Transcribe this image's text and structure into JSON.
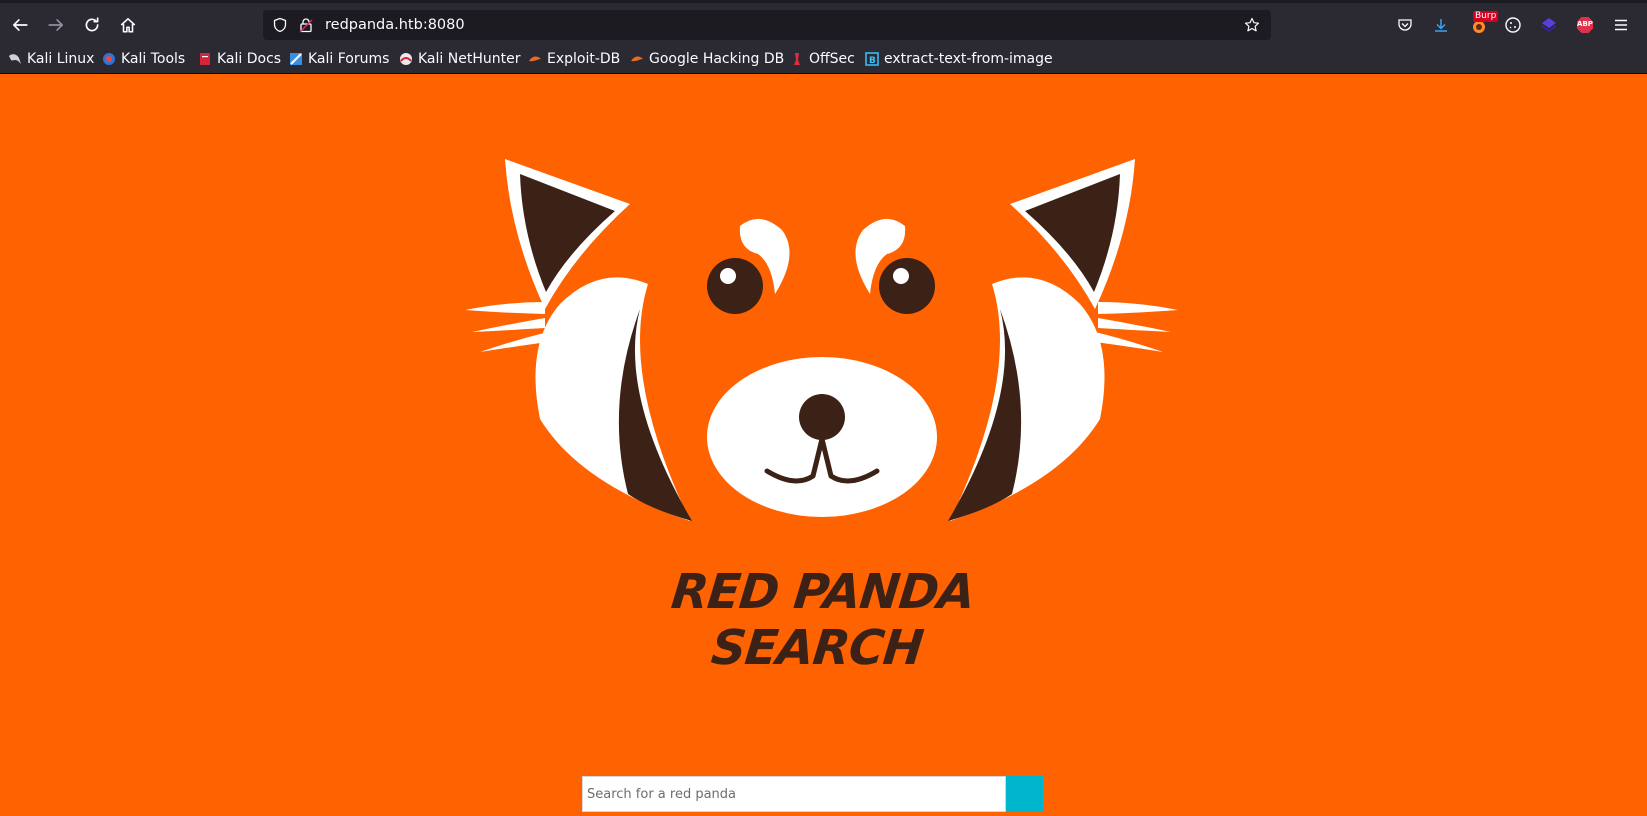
{
  "browser": {
    "url": "redpanda.htb:8080",
    "bookmarks": [
      {
        "label": "Kali Linux",
        "icon": "kali-dragon-icon"
      },
      {
        "label": "Kali Tools",
        "icon": "kali-tools-icon"
      },
      {
        "label": "Kali Docs",
        "icon": "kali-docs-icon"
      },
      {
        "label": "Kali Forums",
        "icon": "kali-forums-icon"
      },
      {
        "label": "Kali NetHunter",
        "icon": "nethunter-icon"
      },
      {
        "label": "Exploit-DB",
        "icon": "exploit-db-icon"
      },
      {
        "label": "Google Hacking DB",
        "icon": "ghdb-icon"
      },
      {
        "label": "OffSec",
        "icon": "offsec-icon"
      },
      {
        "label": "extract-text-from-image",
        "icon": "bookmark-b-icon"
      }
    ],
    "extensions": {
      "burp_badge": "Burp",
      "abp_label": "ABP"
    }
  },
  "page": {
    "brand_title": "RED PANDA SEARCH",
    "search": {
      "placeholder": "Search for a red panda",
      "value": ""
    }
  },
  "colors": {
    "background": "#ff6200",
    "panda_dark": "#3b2116",
    "panda_white": "#ffffff",
    "search_button": "#00b6cc"
  }
}
